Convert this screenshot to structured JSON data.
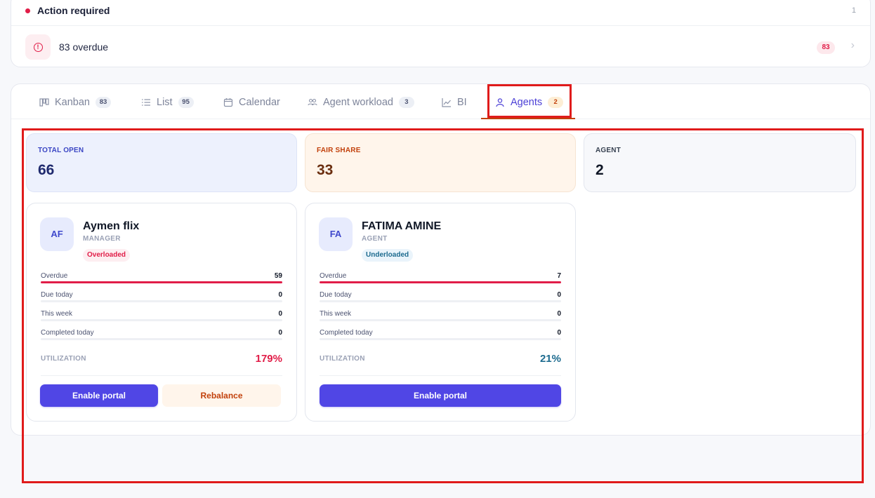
{
  "action": {
    "title": "Action required",
    "count": "1",
    "item_label": "83 overdue",
    "item_badge": "83",
    "accent": "#e11d48"
  },
  "tabs": [
    {
      "label": "Kanban",
      "count": "83",
      "icon": "kanban-icon"
    },
    {
      "label": "List",
      "count": "95",
      "icon": "list-icon"
    },
    {
      "label": "Calendar",
      "count": null,
      "icon": "calendar-icon"
    },
    {
      "label": "Agent workload",
      "count": "3",
      "icon": "users-icon"
    },
    {
      "label": "BI",
      "count": null,
      "icon": "line-chart-icon"
    },
    {
      "label": "Agents",
      "count": "2",
      "icon": "user-icon",
      "active": true
    }
  ],
  "stats": {
    "total_open": {
      "label": "TOTAL OPEN",
      "value": "66"
    },
    "fair_share": {
      "label": "FAIR SHARE",
      "value": "33"
    },
    "agent": {
      "label": "AGENT",
      "value": "2"
    }
  },
  "agents": [
    {
      "initials": "AF",
      "name": "Aymen flix",
      "role": "MANAGER",
      "status": "Overloaded",
      "metrics": [
        {
          "label": "Overdue",
          "value": "59",
          "fill": 1.0
        },
        {
          "label": "Due today",
          "value": "0",
          "fill": 0
        },
        {
          "label": "This week",
          "value": "0",
          "fill": 0
        },
        {
          "label": "Completed today",
          "value": "0",
          "fill": 0
        }
      ],
      "utilization_label": "UTILIZATION",
      "utilization": "179%",
      "buttons": {
        "enable_portal": "Enable portal",
        "rebalance": "Rebalance"
      }
    },
    {
      "initials": "FA",
      "name": "FATIMA AMINE",
      "role": "AGENT",
      "status": "Underloaded",
      "metrics": [
        {
          "label": "Overdue",
          "value": "7",
          "fill": 1.0
        },
        {
          "label": "Due today",
          "value": "0",
          "fill": 0
        },
        {
          "label": "This week",
          "value": "0",
          "fill": 0
        },
        {
          "label": "Completed today",
          "value": "0",
          "fill": 0
        }
      ],
      "utilization_label": "UTILIZATION",
      "utilization": "21%",
      "buttons": {
        "enable_portal": "Enable portal"
      }
    }
  ]
}
